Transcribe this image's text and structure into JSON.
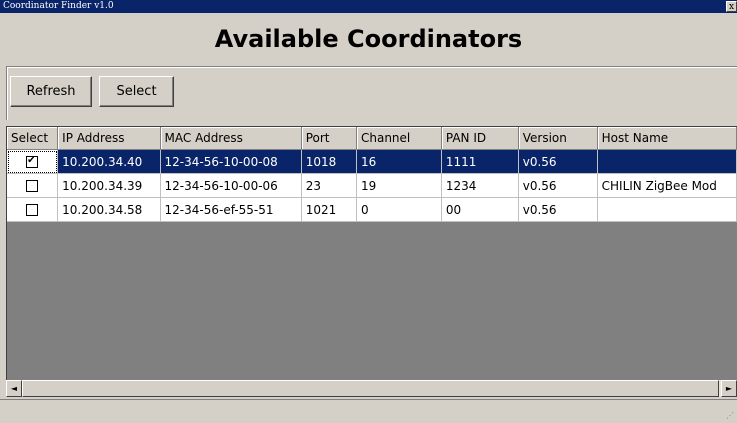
{
  "window": {
    "title": "Coordinator Finder v1.0",
    "close_glyph": "x"
  },
  "heading": "Available Coordinators",
  "toolbar": {
    "refresh_label": "Refresh",
    "select_label": "Select"
  },
  "table": {
    "columns": [
      "Select",
      "IP Address",
      "MAC Address",
      "Port",
      "Channel",
      "PAN ID",
      "Version",
      "Host Name"
    ],
    "rows": [
      {
        "checked": true,
        "selected": true,
        "ip": "10.200.34.40",
        "mac": "12-34-56-10-00-08",
        "port": "1018",
        "channel": "16",
        "pan_id": "1111",
        "version": "v0.56",
        "host": ""
      },
      {
        "checked": false,
        "selected": false,
        "ip": "10.200.34.39",
        "mac": "12-34-56-10-00-06",
        "port": "23",
        "channel": "19",
        "pan_id": "1234",
        "version": "v0.56",
        "host": "CHILIN ZigBee Mod"
      },
      {
        "checked": false,
        "selected": false,
        "ip": "10.200.34.58",
        "mac": "12-34-56-ef-55-51",
        "port": "1021",
        "channel": "0",
        "pan_id": "00",
        "version": "v0.56",
        "host": ""
      }
    ]
  },
  "scrollbar": {
    "left_glyph": "◄",
    "right_glyph": "►"
  },
  "colors": {
    "selection": "#0a246a",
    "window_bg": "#d4d0c8",
    "grid_empty": "#808080"
  }
}
